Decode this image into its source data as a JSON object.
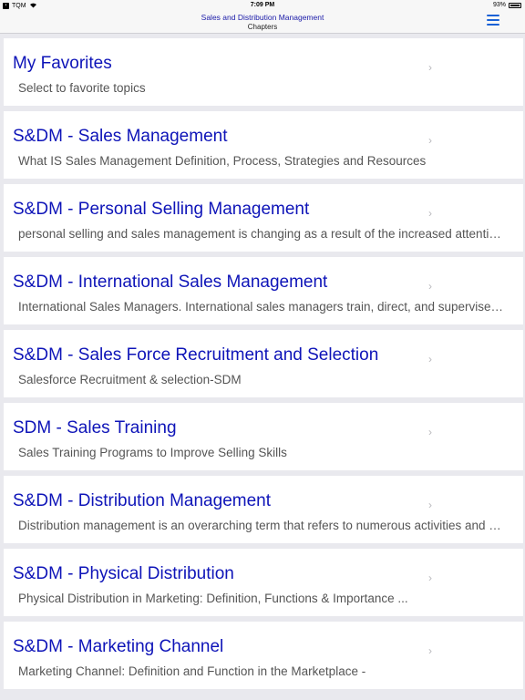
{
  "status_bar": {
    "back_app": "TQM",
    "time": "7:09 PM",
    "battery": "93%"
  },
  "nav": {
    "title": "Sales and Distribution Management",
    "subtitle": "Chapters",
    "menu_icon": "hamburger-menu-icon"
  },
  "chevron_glyph": "›",
  "items": [
    {
      "title": "My Favorites",
      "desc": "Select to favorite topics"
    },
    {
      "title": "S&DM - Sales Management",
      "desc": "What IS Sales Management Definition, Process, Strategies and Resources"
    },
    {
      "title": "S&DM - Personal Selling Management",
      "desc": "personal selling and sales management is changing as a result of the increased attention on the customer and the growing importance of relationships"
    },
    {
      "title": "S&DM - International Sales Management",
      "desc": "International Sales Managers. International sales managers train, direct, and supervise a sales team"
    },
    {
      "title": "S&DM - Sales Force Recruitment and Selection",
      "desc": "Salesforce Recruitment & selection-SDM"
    },
    {
      "title": "SDM - Sales Training",
      "desc": "Sales Training Programs to Improve Selling Skills"
    },
    {
      "title": "S&DM - Distribution Management",
      "desc": "Distribution management is an overarching term that refers to numerous activities and processes"
    },
    {
      "title": "S&DM - Physical Distribution",
      "desc": "Physical Distribution in Marketing: Definition, Functions & Importance ..."
    },
    {
      "title": "S&DM - Marketing Channel",
      "desc": "Marketing Channel: Definition and Function in the Marketplace -"
    }
  ]
}
